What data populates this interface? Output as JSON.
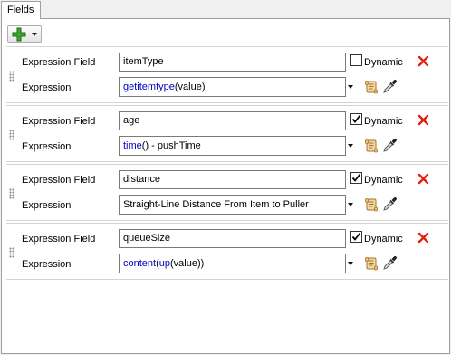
{
  "tab": {
    "label": "Fields"
  },
  "toolbar": {
    "add_icon": "green-plus-icon",
    "dropdown_icon": "caret-down-icon"
  },
  "fields": [
    {
      "expression_field_label": "Expression Field",
      "expression_field_value": "itemType",
      "dynamic_label": "Dynamic",
      "dynamic_checked": false,
      "expression_label": "Expression",
      "expression_tokens": [
        {
          "text": "getitemtype",
          "kw": true
        },
        {
          "text": "(value)",
          "kw": false
        }
      ]
    },
    {
      "expression_field_label": "Expression Field",
      "expression_field_value": "age",
      "dynamic_label": "Dynamic",
      "dynamic_checked": true,
      "expression_label": "Expression",
      "expression_tokens": [
        {
          "text": "time",
          "kw": true
        },
        {
          "text": "() - pushTime",
          "kw": false
        }
      ]
    },
    {
      "expression_field_label": "Expression Field",
      "expression_field_value": "distance",
      "dynamic_label": "Dynamic",
      "dynamic_checked": true,
      "expression_label": "Expression",
      "expression_tokens": [
        {
          "text": "Straight-Line Distance From Item to Puller",
          "kw": false
        }
      ]
    },
    {
      "expression_field_label": "Expression Field",
      "expression_field_value": "queueSize",
      "dynamic_label": "Dynamic",
      "dynamic_checked": true,
      "expression_label": "Expression",
      "expression_tokens": [
        {
          "text": "content",
          "kw": true
        },
        {
          "text": "(",
          "kw": false
        },
        {
          "text": "up",
          "kw": true
        },
        {
          "text": "(value))",
          "kw": false
        }
      ]
    }
  ],
  "colors": {
    "keyword": "#0000c0",
    "delete": "#e02010",
    "add": "#2a9a20"
  }
}
